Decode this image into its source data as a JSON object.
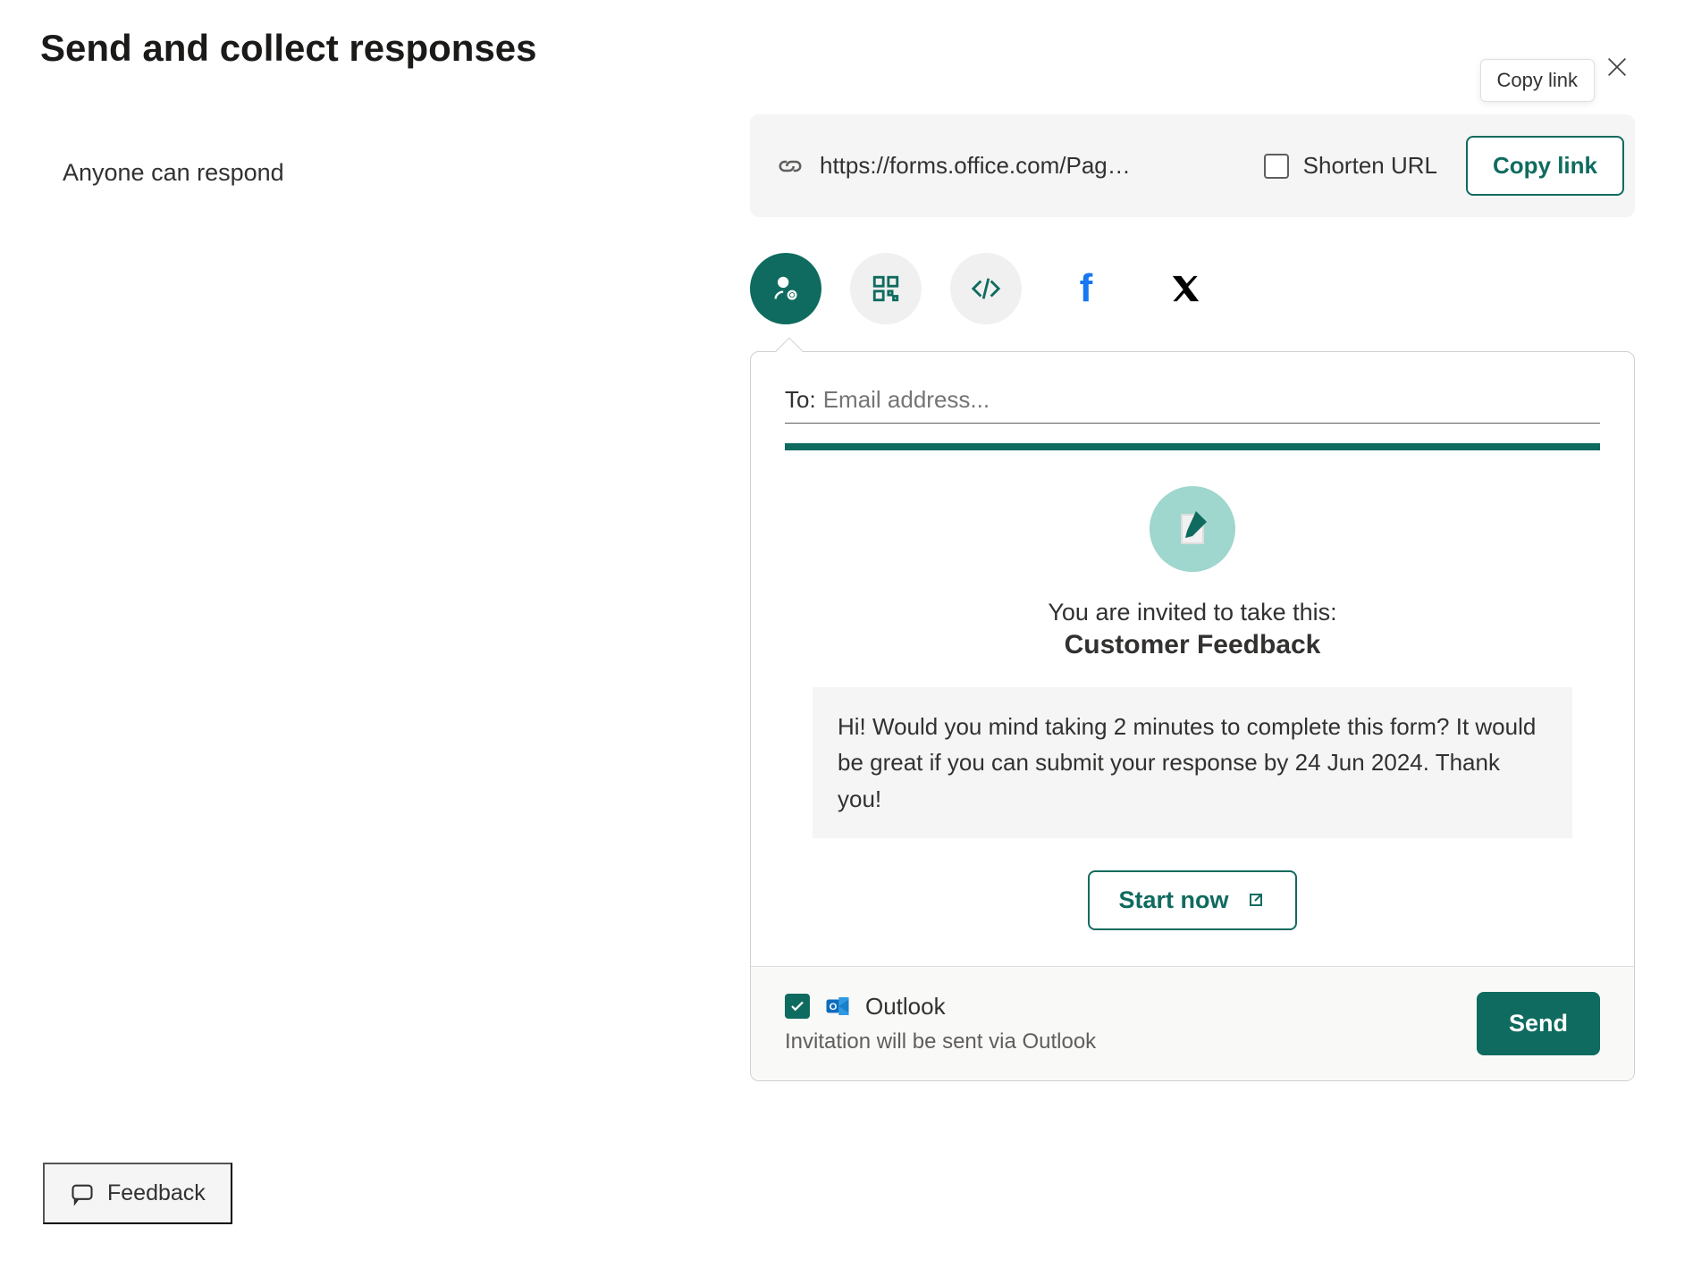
{
  "header": {
    "title": "Send and collect responses"
  },
  "permission": {
    "label": "Anyone can respond"
  },
  "link": {
    "url": "https://forms.office.com/Pag…",
    "shorten_label": "Shorten URL",
    "copy_label": "Copy link",
    "tooltip": "Copy link"
  },
  "email": {
    "to_label": "To:",
    "to_placeholder": "Email address...",
    "invite_line": "You are invited to take this:",
    "form_title": "Customer Feedback",
    "message": "Hi! Would you mind taking 2 minutes to complete this form? It would be great if you can submit your response by 24 Jun 2024. Thank you!",
    "start_label": "Start now"
  },
  "outlook": {
    "label": "Outlook",
    "subtext": "Invitation will be sent via Outlook",
    "send_label": "Send"
  },
  "feedback": {
    "label": "Feedback"
  }
}
